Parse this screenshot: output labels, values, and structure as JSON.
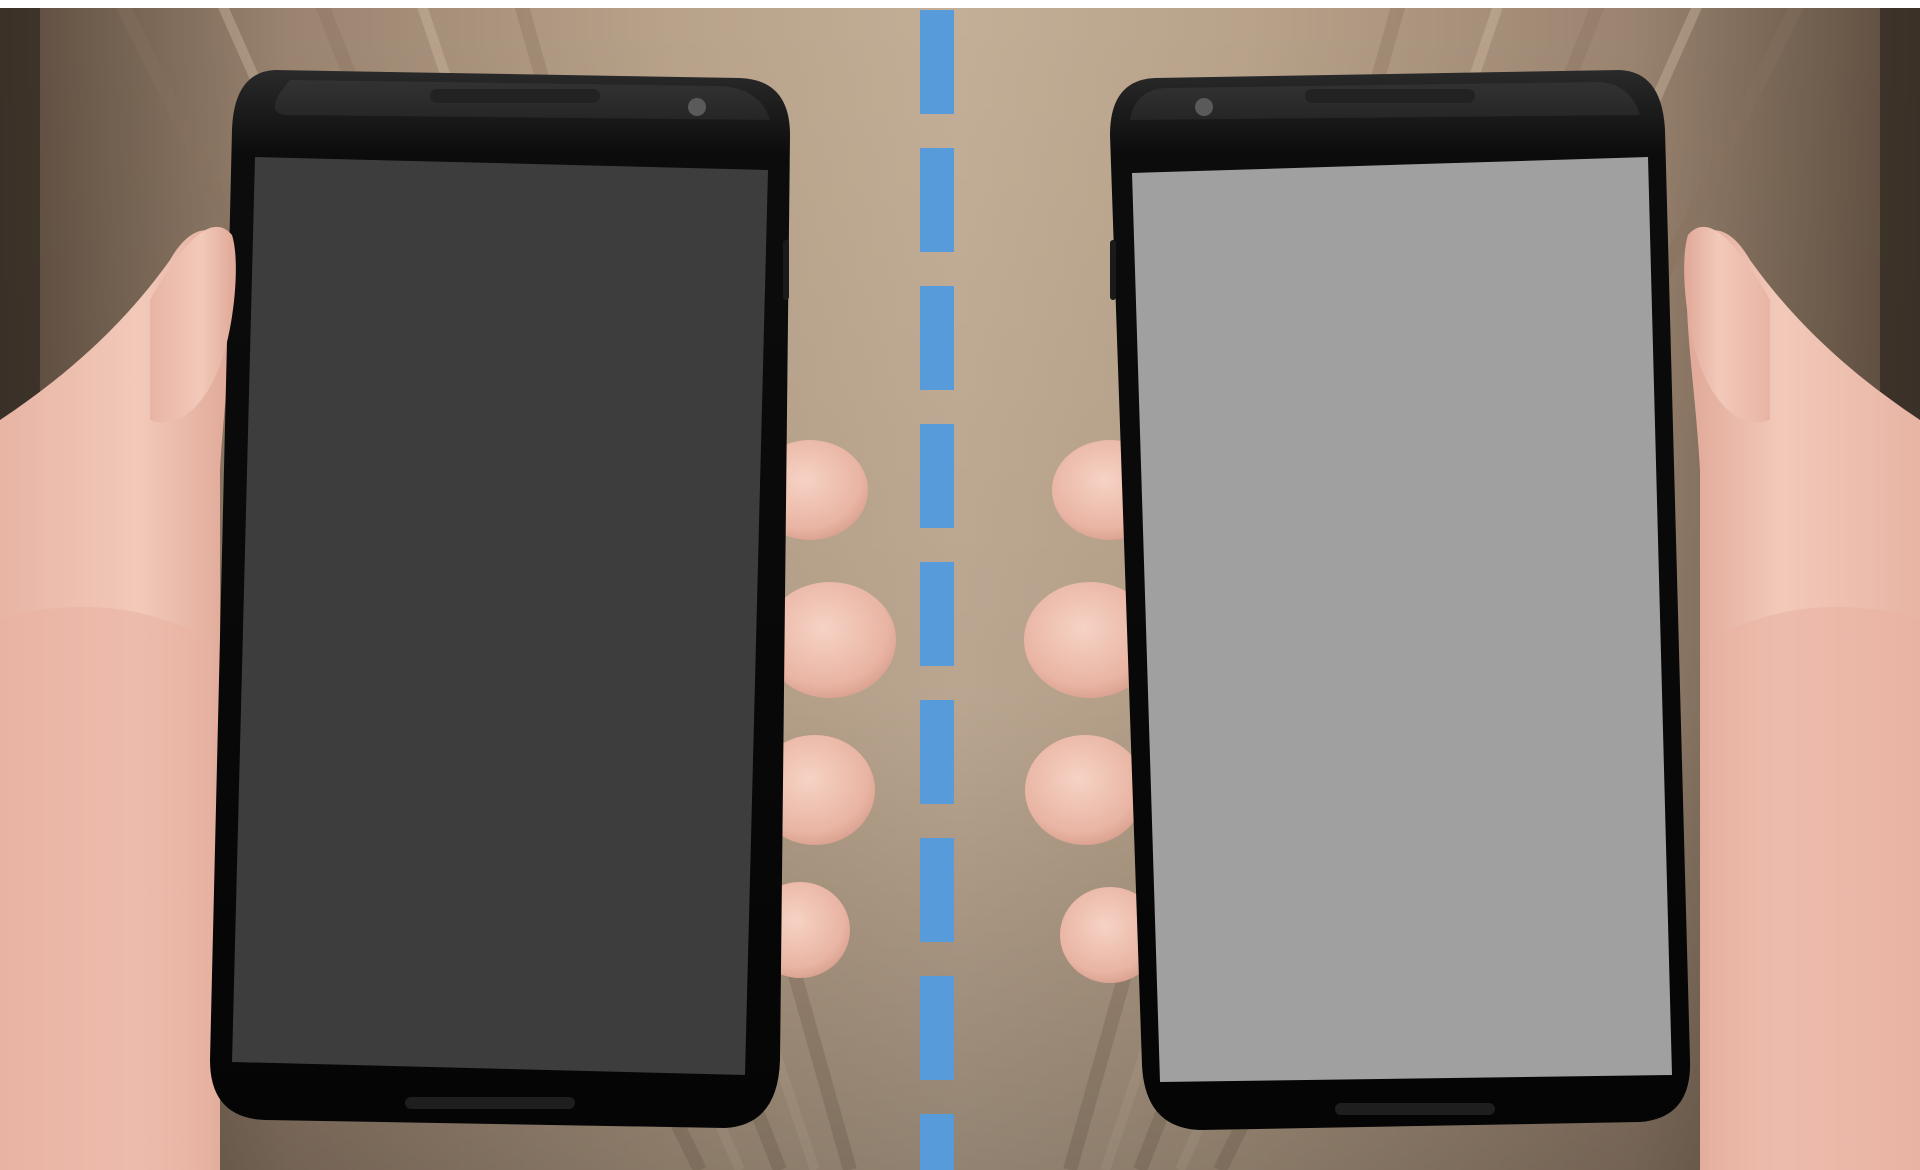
{
  "scene": {
    "description_type": "photo-comparison",
    "panels": [
      {
        "id": "left",
        "hand": "left",
        "screen_color": "#3d3d3d",
        "screen_state": "dark"
      },
      {
        "id": "right",
        "hand": "right",
        "screen_color": "#a0a0a0",
        "screen_state": "light"
      }
    ],
    "divider": {
      "style": "dashed",
      "color": "#579bdb"
    },
    "colors": {
      "background_wood_light": "#b59f87",
      "background_wood_dark": "#6f5a45",
      "phone_body": "#0c0c0c",
      "phone_bezel": "#151515",
      "skin_light": "#f0c4b3",
      "skin_shadow": "#c98f80"
    }
  }
}
